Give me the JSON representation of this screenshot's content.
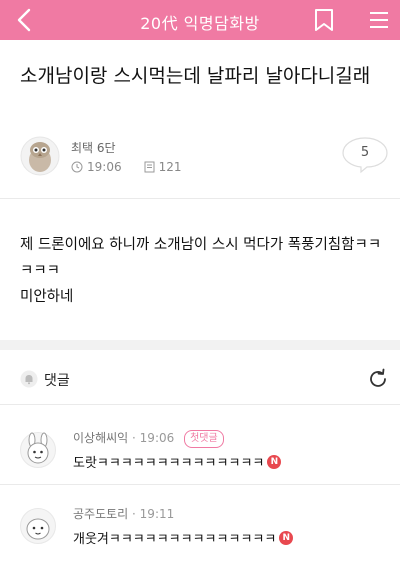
{
  "header": {
    "title": "20代 익명담화방",
    "colors": {
      "background": "#f07aa3",
      "text": "#ffffff"
    }
  },
  "post": {
    "title": "소개남이랑 스시먹는데 날파리 날아다니길래",
    "author": "최택 6단",
    "time": "19:06",
    "views": "121",
    "comment_count": "5",
    "body_lines": [
      "제 드론이에요 하니까 소개남이 스시 먹다가 폭풍기침함ㅋㅋㅋㅋㅋ",
      "미안하네"
    ]
  },
  "comments_section": {
    "label": "댓글",
    "comments": [
      {
        "name": "이상해씨익",
        "time": "19:06",
        "badge": "첫댓글",
        "text": "도랏ㅋㅋㅋㅋㅋㅋㅋㅋㅋㅋㅋㅋㅋㅋ",
        "new_mark": "N"
      },
      {
        "name": "공주도토리",
        "time": "19:11",
        "badge": "",
        "text": "개웃겨ㅋㅋㅋㅋㅋㅋㅋㅋㅋㅋㅋㅋㅋㅋ",
        "new_mark": "N"
      }
    ]
  }
}
